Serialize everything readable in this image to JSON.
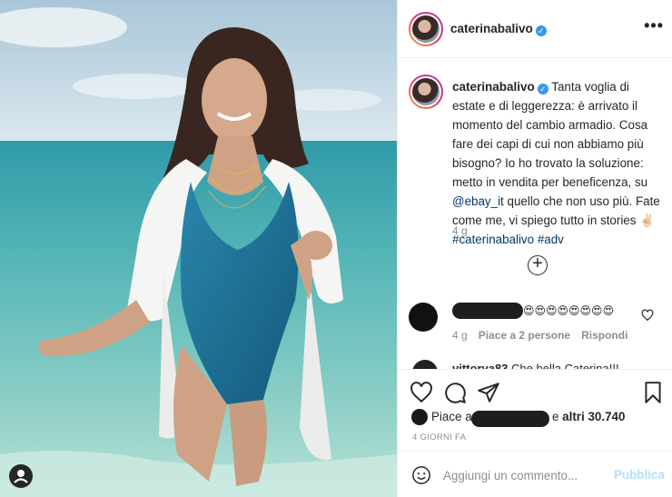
{
  "post": {
    "username": "caterinabalivo",
    "verified_glyph": "✓",
    "more_glyph": "•••",
    "caption": {
      "text": "Tanta voglia di estate e di leggerezza: è arrivato il momento del cambio armadio. Cosa fare dei capi di cui non abbiamo più bisogno? Io ho trovato la soluzione: metto in vendita per beneficenza, su ",
      "mention": "@ebay_it",
      "text2": " quello che non uso più. Fate come me, vi spiego tutto in stories ✌🏻",
      "hashtag1": "#caterinabalivo",
      "hashtag2": "#adv",
      "time": "4 g"
    },
    "load_more_glyph": "+",
    "comments": [
      {
        "text": "😍😍😍😍😍😍😍😍",
        "time": "4 g",
        "likes": "Piace a 2 persone",
        "reply": "Rispondi"
      },
      {
        "username": "vittorya83",
        "text": "Che bella Caterina!!!"
      }
    ],
    "likes": {
      "prefix": "Piace a",
      "suffix_pre": "e ",
      "suffix_bold": "altri 30.740"
    },
    "date": "4 GIORNI FA",
    "add_comment": {
      "placeholder": "Aggiungi un commento...",
      "publish": "Pubblica"
    }
  },
  "icons": [
    "heart-icon",
    "comment-icon",
    "share-icon",
    "bookmark-icon",
    "emoji-icon",
    "user-tag-icon",
    "more-options-icon",
    "plus-circle-icon"
  ],
  "colors": {
    "link": "#00376b",
    "muted": "#8e8e8e",
    "publish_disabled": "#b2dffc",
    "verified": "#3897f0",
    "swimsuit": "#1f6f94",
    "sea": "#58b7b8"
  }
}
